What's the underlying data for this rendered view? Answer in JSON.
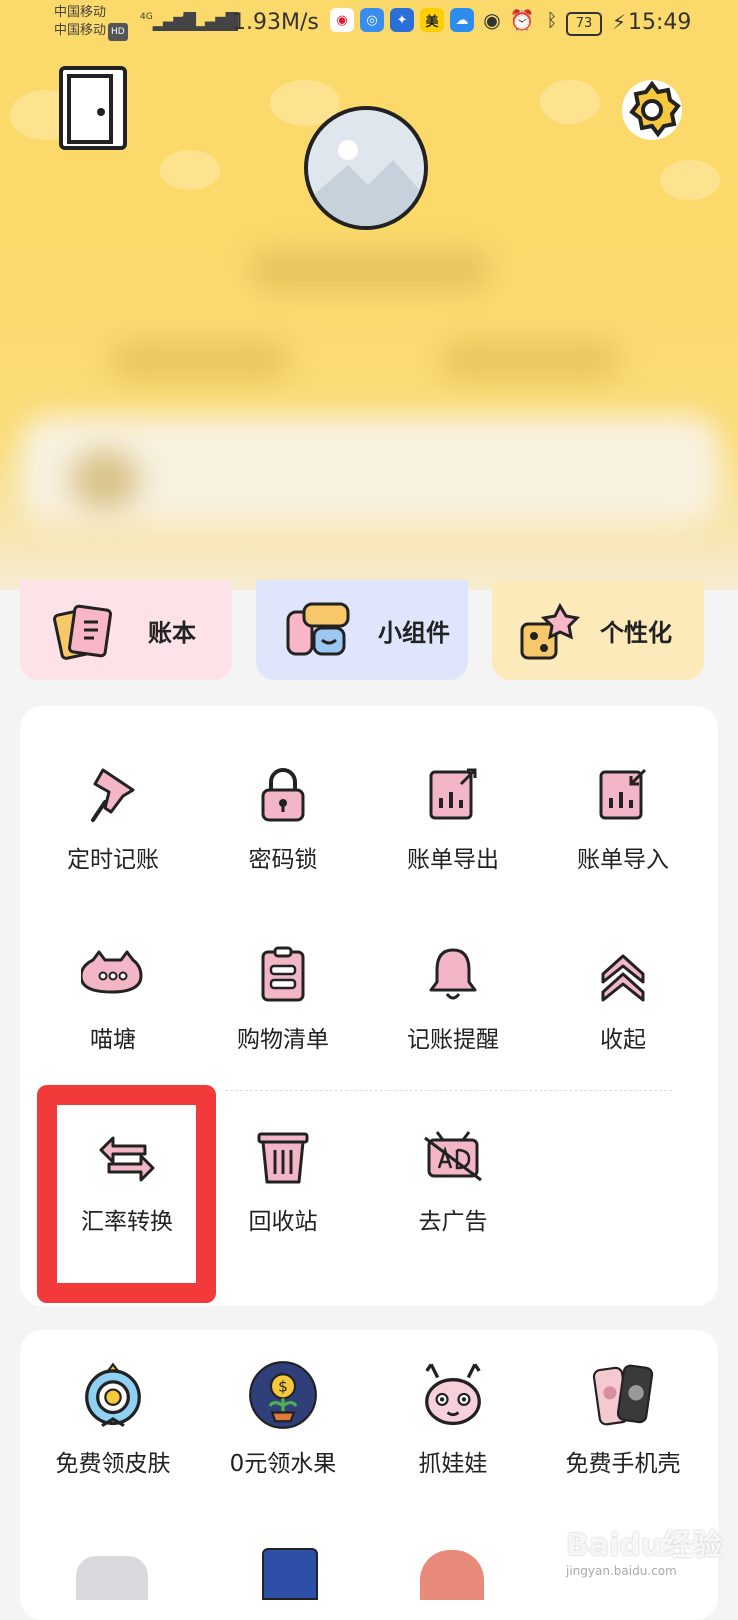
{
  "status_bar": {
    "carrier_1": "中国移动",
    "carrier_2": "中国移动",
    "hd": "HD",
    "net_1": "4G",
    "net_2": "4G",
    "speed": "1.93M/s",
    "app_icon_meituan": "美",
    "battery": "73",
    "time": "15:49"
  },
  "quick_actions": [
    {
      "label": "账本",
      "icon": "ledger-book-icon",
      "bg": "#fde2e7"
    },
    {
      "label": "小组件",
      "icon": "widget-icon",
      "bg": "#dfe5fb"
    },
    {
      "label": "个性化",
      "icon": "personalize-icon",
      "bg": "#fdeaba"
    }
  ],
  "tools": [
    {
      "label": "定时记账",
      "icon": "pushpin-icon"
    },
    {
      "label": "密码锁",
      "icon": "padlock-icon"
    },
    {
      "label": "账单导出",
      "icon": "bill-export-icon"
    },
    {
      "label": "账单导入",
      "icon": "bill-import-icon"
    },
    {
      "label": "喵塘",
      "icon": "chat-bubble-cat-icon"
    },
    {
      "label": "购物清单",
      "icon": "clipboard-list-icon"
    },
    {
      "label": "记账提醒",
      "icon": "bell-icon"
    },
    {
      "label": "收起",
      "icon": "collapse-chevrons-up-icon"
    },
    {
      "label": "汇率转换",
      "icon": "exchange-arrows-icon"
    },
    {
      "label": "回收站",
      "icon": "trash-bin-icon"
    },
    {
      "label": "去广告",
      "icon": "no-ads-icon"
    }
  ],
  "promos": [
    {
      "label": "免费领皮肤",
      "icon": "skin-badge-icon"
    },
    {
      "label": "0元领水果",
      "icon": "fruit-coin-plant-icon"
    },
    {
      "label": "抓娃娃",
      "icon": "rabbit-doll-icon"
    },
    {
      "label": "免费手机壳",
      "icon": "phone-case-icon"
    }
  ],
  "watermark": {
    "text": "Baidu经验",
    "url": "jingyan.baidu.com"
  },
  "colors": {
    "accent_yellow": "#fbd96a",
    "icon_pink": "#f2b6c6",
    "highlight_red": "#f33a3a"
  }
}
